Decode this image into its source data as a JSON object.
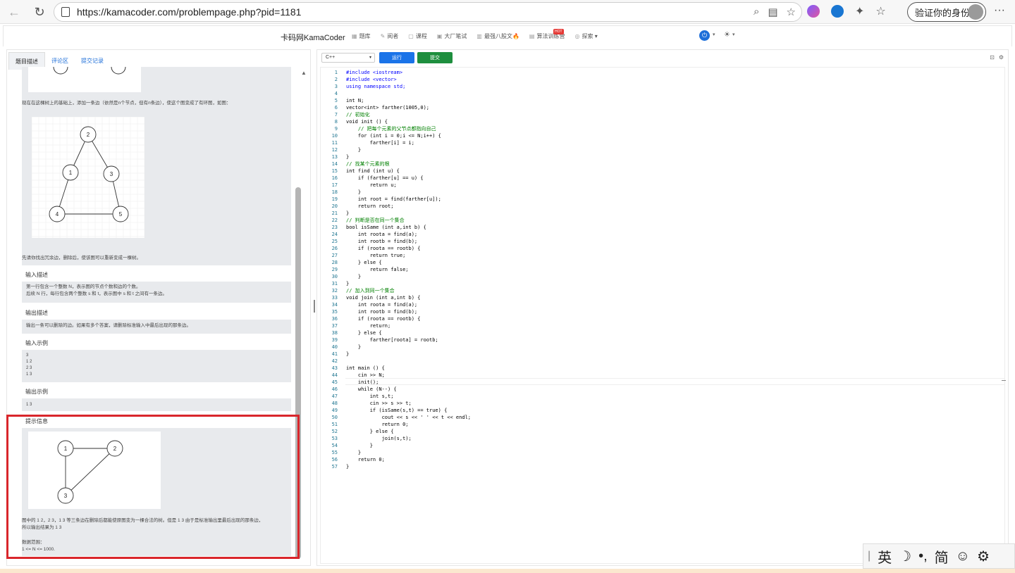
{
  "browser": {
    "url": "https://kamacoder.com/problempage.php?pid=1181",
    "verify_label": "验证你的身份"
  },
  "site": {
    "title": "卡码网KamaCoder",
    "nav": [
      "题库",
      "阅者",
      "课程",
      "大厂笔试",
      "最强八股文🔥",
      "算法训练营",
      "探索"
    ],
    "hot_badge": "HOT",
    "theme_icon": "sun-icon"
  },
  "tabs": [
    "题目描述",
    "评论区",
    "提交记录"
  ],
  "problem": {
    "desc_text": "现在在这棵树上的基础上，添加一条边（依然是n个节点，但有n条边），使这个图变成了有环图，如图：",
    "desc_text2": "先请你找出冗余边，删除后，使该图可以重新变成一棵树。",
    "input_label": "输入描述",
    "input_desc1": "第一行包含一个整数 N，表示图的节点个数和边的个数。",
    "input_desc2": "后续 N 行，每行包含两个整数 s 和 t，表示图中 s 和 t 之间有一条边。",
    "output_label": "输出描述",
    "output_desc": "输出一条可以删除的边。如果有多个答案，请删除标准输入中最后出现的那条边。",
    "input_example_label": "输入示例",
    "input_example": [
      "3",
      "1 2",
      "2 3",
      "1 3"
    ],
    "output_example_label": "输出示例",
    "output_example": "1 3",
    "hint_label": "提示信息",
    "hint_text1": "图中的 1 2，2 3，1 3 等三条边在删除后都能使原图变为一棵合法的树。但是 1 3 由于是标准输出里最后出现的那条边，",
    "hint_text2": "所以输出结果为 1 3",
    "range_label": "数据范围：",
    "range_value": "1 <= N <= 1000."
  },
  "graph_main": {
    "nodes": [
      {
        "id": "2"
      },
      {
        "id": "1"
      },
      {
        "id": "3"
      },
      {
        "id": "4"
      },
      {
        "id": "5"
      }
    ]
  },
  "graph_hint": {
    "nodes": [
      {
        "id": "1"
      },
      {
        "id": "2"
      },
      {
        "id": "3"
      }
    ]
  },
  "editor": {
    "language": "C++",
    "run_label": "运行",
    "submit_label": "提交",
    "lines": [
      {
        "n": "1",
        "t": "#include <iostream>",
        "c": "kw"
      },
      {
        "n": "2",
        "t": "#include <vector>",
        "c": "kw"
      },
      {
        "n": "3",
        "t": "using namespace std;",
        "c": "kw"
      },
      {
        "n": "4",
        "t": "",
        "c": ""
      },
      {
        "n": "5",
        "t": "int N;",
        "c": ""
      },
      {
        "n": "6",
        "t": "vector<int> farther(1005,0);",
        "c": ""
      },
      {
        "n": "7",
        "t": "// 初始化",
        "c": "cm"
      },
      {
        "n": "8",
        "t": "void init () {",
        "c": ""
      },
      {
        "n": "9",
        "t": "    // 把每个元素的父节点都指向自己",
        "c": "cm"
      },
      {
        "n": "10",
        "t": "    for (int i = 0;i <= N;i++) {",
        "c": ""
      },
      {
        "n": "11",
        "t": "        farther[i] = i;",
        "c": ""
      },
      {
        "n": "12",
        "t": "    }",
        "c": ""
      },
      {
        "n": "13",
        "t": "}",
        "c": ""
      },
      {
        "n": "14",
        "t": "// 找某个元素的根",
        "c": "cm"
      },
      {
        "n": "15",
        "t": "int find (int u) {",
        "c": ""
      },
      {
        "n": "16",
        "t": "    if (farther[u] == u) {",
        "c": ""
      },
      {
        "n": "17",
        "t": "        return u;",
        "c": ""
      },
      {
        "n": "18",
        "t": "    }",
        "c": ""
      },
      {
        "n": "19",
        "t": "    int root = find(farther[u]);",
        "c": ""
      },
      {
        "n": "20",
        "t": "    return root;",
        "c": ""
      },
      {
        "n": "21",
        "t": "}",
        "c": ""
      },
      {
        "n": "22",
        "t": "// 判断是否在同一个集合",
        "c": "cm"
      },
      {
        "n": "23",
        "t": "bool isSame (int a,int b) {",
        "c": ""
      },
      {
        "n": "24",
        "t": "    int roota = find(a);",
        "c": ""
      },
      {
        "n": "25",
        "t": "    int rootb = find(b);",
        "c": ""
      },
      {
        "n": "26",
        "t": "    if (roota == rootb) {",
        "c": ""
      },
      {
        "n": "27",
        "t": "        return true;",
        "c": ""
      },
      {
        "n": "28",
        "t": "    } else {",
        "c": ""
      },
      {
        "n": "29",
        "t": "        return false;",
        "c": ""
      },
      {
        "n": "30",
        "t": "    }",
        "c": ""
      },
      {
        "n": "31",
        "t": "}",
        "c": ""
      },
      {
        "n": "32",
        "t": "// 加入到同一个集合",
        "c": "cm"
      },
      {
        "n": "33",
        "t": "void join (int a,int b) {",
        "c": ""
      },
      {
        "n": "34",
        "t": "    int roota = find(a);",
        "c": ""
      },
      {
        "n": "35",
        "t": "    int rootb = find(b);",
        "c": ""
      },
      {
        "n": "36",
        "t": "    if (roota == rootb) {",
        "c": ""
      },
      {
        "n": "37",
        "t": "        return;",
        "c": ""
      },
      {
        "n": "38",
        "t": "    } else {",
        "c": ""
      },
      {
        "n": "39",
        "t": "        farther[roota] = rootb;",
        "c": ""
      },
      {
        "n": "40",
        "t": "    }",
        "c": ""
      },
      {
        "n": "41",
        "t": "}",
        "c": ""
      },
      {
        "n": "42",
        "t": "",
        "c": ""
      },
      {
        "n": "43",
        "t": "int main () {",
        "c": ""
      },
      {
        "n": "44",
        "t": "    cin >> N;",
        "c": ""
      },
      {
        "n": "45",
        "t": "    init();",
        "c": ""
      },
      {
        "n": "46",
        "t": "    while (N--) {",
        "c": ""
      },
      {
        "n": "47",
        "t": "        int s,t;",
        "c": ""
      },
      {
        "n": "48",
        "t": "        cin >> s >> t;",
        "c": ""
      },
      {
        "n": "49",
        "t": "        if (isSame(s,t) == true) {",
        "c": ""
      },
      {
        "n": "50",
        "t": "            cout << s << ' ' << t << endl;",
        "c": ""
      },
      {
        "n": "51",
        "t": "            return 0;",
        "c": ""
      },
      {
        "n": "52",
        "t": "        } else {",
        "c": ""
      },
      {
        "n": "53",
        "t": "            join(s,t);",
        "c": ""
      },
      {
        "n": "54",
        "t": "        }",
        "c": ""
      },
      {
        "n": "55",
        "t": "    }",
        "c": ""
      },
      {
        "n": "56",
        "t": "    return 0;",
        "c": ""
      },
      {
        "n": "57",
        "t": "}",
        "c": ""
      }
    ]
  },
  "ime": {
    "labels": [
      "英",
      "☽",
      "•,",
      "简",
      "☺",
      "⚙"
    ]
  },
  "colors": {
    "accent": "#1a73e8",
    "submit": "#1e8e3e",
    "highlight_frame": "#d9262b",
    "panel_gray": "#e8eaed"
  }
}
